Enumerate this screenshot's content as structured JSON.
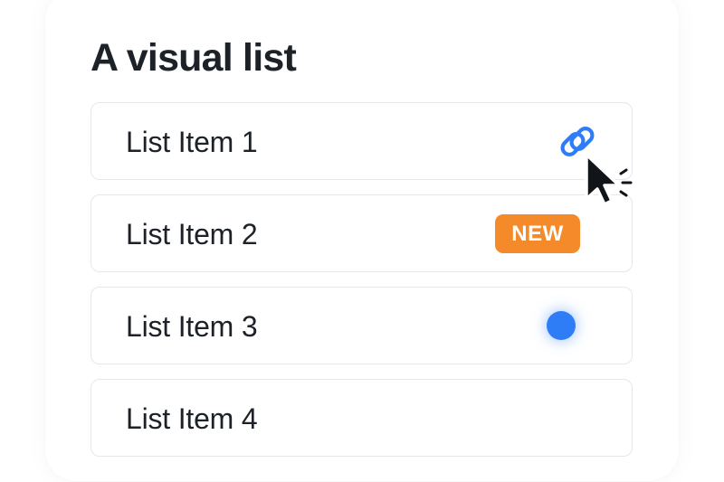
{
  "title": "A visual list",
  "items": [
    {
      "label": "List Item 1",
      "accessory": "link-icon"
    },
    {
      "label": "List Item 2",
      "accessory": "badge",
      "badge_text": "NEW"
    },
    {
      "label": "List Item 3",
      "accessory": "status-dot"
    },
    {
      "label": "List Item 4",
      "accessory": "none"
    }
  ],
  "colors": {
    "text": "#1d2228",
    "accent_blue": "#2f7df6",
    "badge_orange": "#f58a2a",
    "border": "#e5e7ea",
    "cursor": "#111418"
  },
  "icons": [
    "link-icon",
    "mouse-pointer-icon"
  ]
}
